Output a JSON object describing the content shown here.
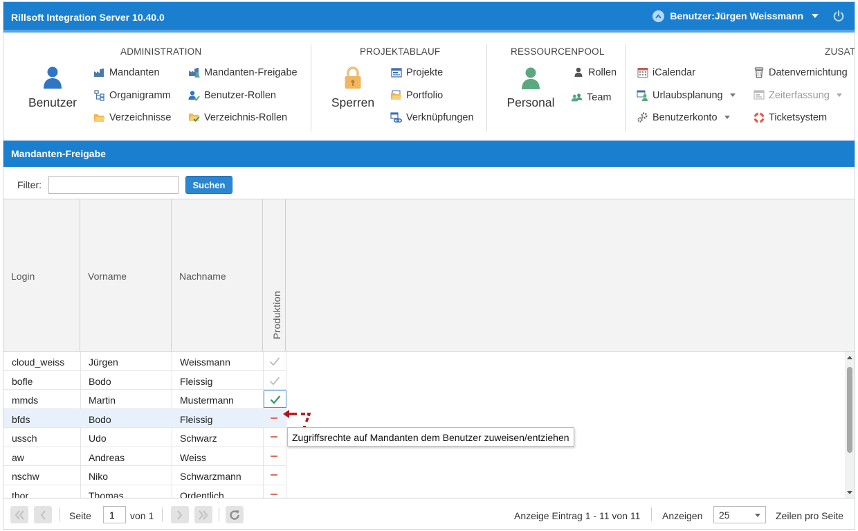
{
  "app": {
    "title": "Rillsoft Integration Server 10.40.0",
    "user": "Benutzer:Jürgen Weissmann"
  },
  "ribbon": {
    "administration": {
      "title": "ADMINISTRATION",
      "big": "Benutzer",
      "items": [
        "Mandanten",
        "Organigramm",
        "Verzeichnisse",
        "Mandanten-Freigabe",
        "Benutzer-Rollen",
        "Verzeichnis-Rollen"
      ]
    },
    "projektablauf": {
      "title": "PROJEKTABLAUF",
      "big": "Sperren",
      "items": [
        "Projekte",
        "Portfolio",
        "Verknüpfungen"
      ]
    },
    "ressourcenpool": {
      "title": "RESSOURCENPOOL",
      "big": "Personal",
      "items": [
        "Rollen",
        "Team"
      ]
    },
    "zusatz": {
      "title": "ZUSAT",
      "items": [
        "iCalendar",
        "Urlaubsplanung",
        "Benutzerkonto",
        "Datenvernichtung",
        "Zeiterfassung",
        "Ticketsystem"
      ]
    }
  },
  "section": {
    "title": "Mandanten-Freigabe"
  },
  "filter": {
    "label": "Filter:",
    "value": "",
    "button": "Suchen"
  },
  "grid": {
    "columns": [
      "Login",
      "Vorname",
      "Nachname",
      "Produktion"
    ],
    "rows": [
      {
        "login": "cloud_weiss",
        "vorname": "Jürgen",
        "nachname": "Weissmann",
        "produktion": "check-gray"
      },
      {
        "login": "bofle",
        "vorname": "Bodo",
        "nachname": "Fleissig",
        "produktion": "check-gray"
      },
      {
        "login": "mmds",
        "vorname": "Martin",
        "nachname": "Mustermann",
        "produktion": "check-green"
      },
      {
        "login": "bfds",
        "vorname": "Bodo",
        "nachname": "Fleissig",
        "produktion": "minus"
      },
      {
        "login": "ussch",
        "vorname": "Udo",
        "nachname": "Schwarz",
        "produktion": "minus"
      },
      {
        "login": "aw",
        "vorname": "Andreas",
        "nachname": "Weiss",
        "produktion": "minus"
      },
      {
        "login": "nschw",
        "vorname": "Niko",
        "nachname": "Schwarzmann",
        "produktion": "minus"
      },
      {
        "login": "thor",
        "vorname": "Thomas",
        "nachname": "Ordentlich",
        "produktion": "minus"
      }
    ]
  },
  "tooltip": {
    "text": "Zugriffsrechte auf Mandanten dem Benutzer zuweisen/entziehen"
  },
  "pager": {
    "page_label": "Seite",
    "page_value": "1",
    "of_label": "von 1",
    "display_info": "Anzeige Eintrag 1 - 11 von 11",
    "show_label": "Anzeigen",
    "page_size": "25",
    "rows_label": "Zeilen pro Seite"
  },
  "colors": {
    "header_blue": "#1b7fd0",
    "check_green": "#3a9a6e",
    "minus_red": "#e06a5b",
    "annotation_red": "#b0141a"
  }
}
